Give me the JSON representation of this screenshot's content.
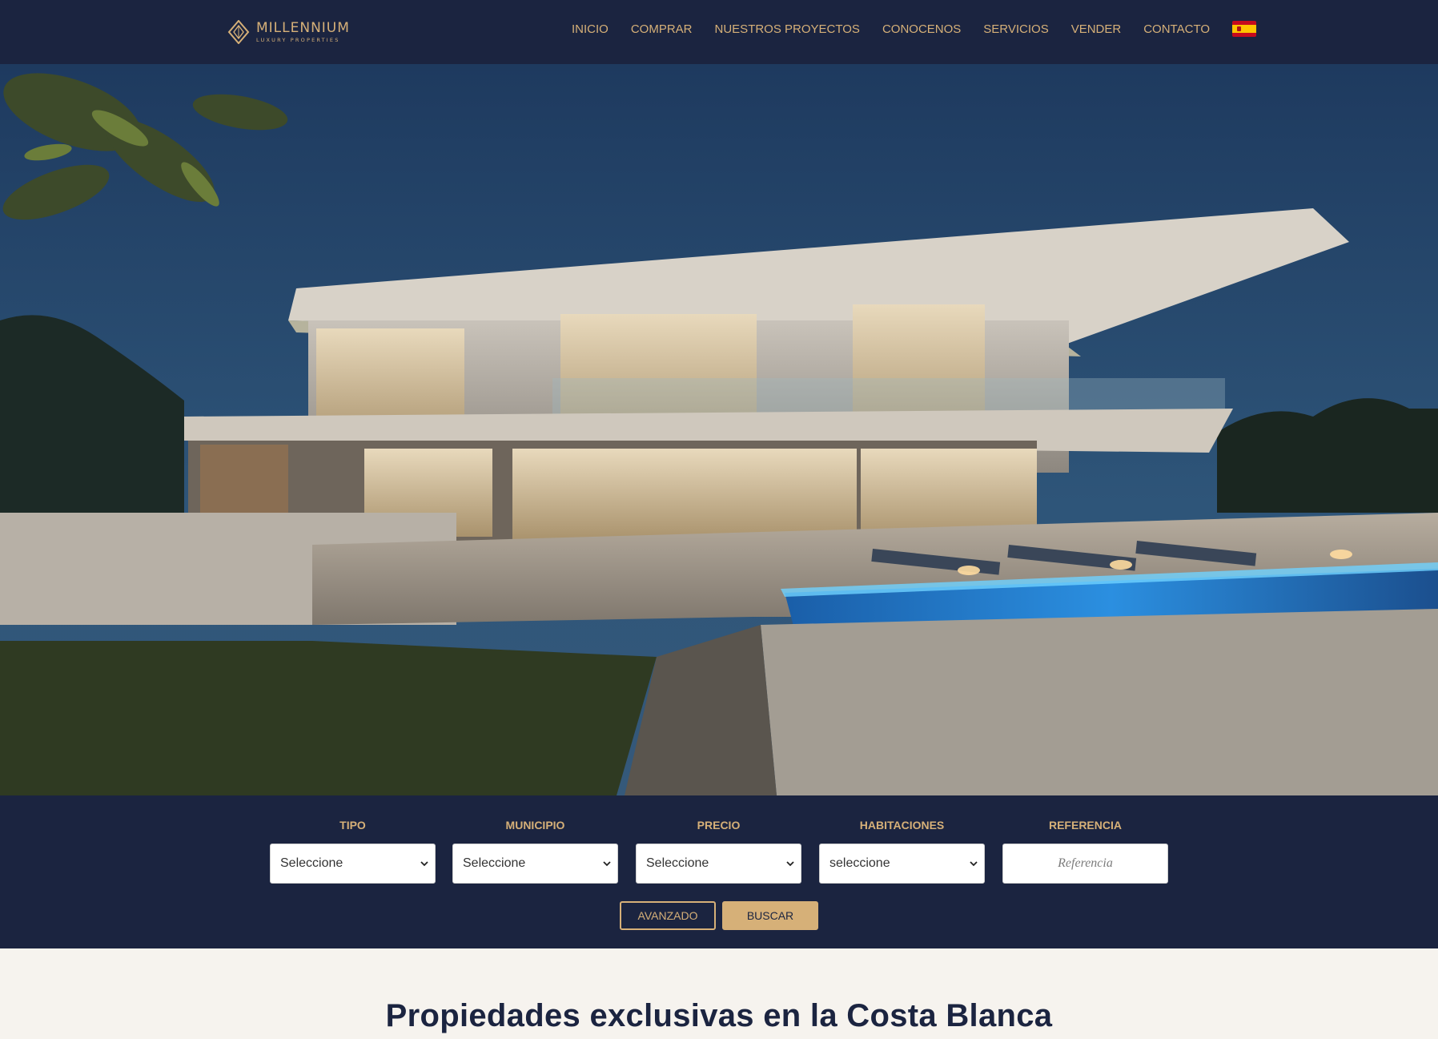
{
  "brand": {
    "name": "MILLENNIUM",
    "tagline": "LUXURY PROPERTIES"
  },
  "nav": {
    "items": [
      {
        "label": "INICIO"
      },
      {
        "label": "COMPRAR"
      },
      {
        "label": "NUESTROS PROYECTOS"
      },
      {
        "label": "CONOCENOS"
      },
      {
        "label": "SERVICIOS"
      },
      {
        "label": "VENDER"
      },
      {
        "label": "CONTACTO"
      }
    ],
    "language_icon": "spain-flag-icon"
  },
  "hero": {
    "image": "modern-villa-night-photo"
  },
  "search": {
    "fields": [
      {
        "label": "TIPO",
        "value": "Seleccione"
      },
      {
        "label": "MUNICIPIO",
        "value": "Seleccione"
      },
      {
        "label": "PRECIO",
        "value": "Seleccione"
      },
      {
        "label": "HABITACIONES",
        "value": "seleccione"
      }
    ],
    "reference": {
      "label": "REFERENCIA",
      "placeholder": "Referencia"
    },
    "advanced_label": "AVANZADO",
    "search_label": "BUSCAR"
  },
  "section": {
    "title": "Propiedades exclusivas en la Costa Blanca"
  },
  "colors": {
    "navy": "#1b2440",
    "gold": "#d6b078",
    "background": "#f6f3ee"
  }
}
